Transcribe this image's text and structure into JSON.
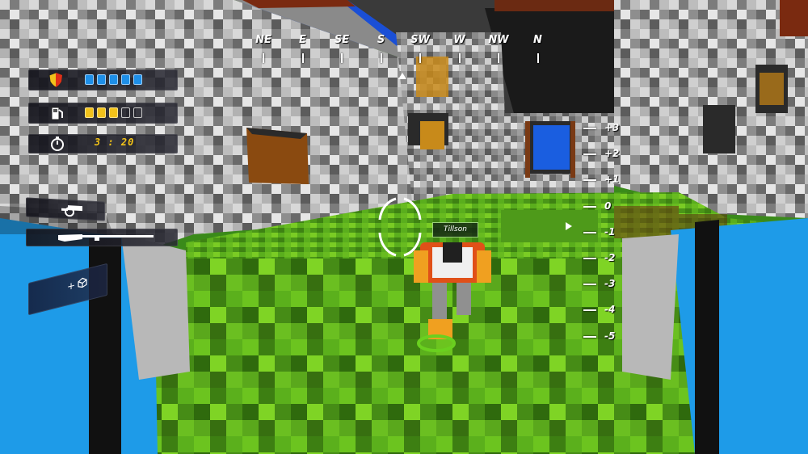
{
  "hud": {
    "compass": {
      "headings": [
        "NE",
        "E",
        "SE",
        "S",
        "SW",
        "W",
        "NW",
        "N"
      ]
    },
    "pitch_ladder": {
      "values": [
        "+3",
        "+2",
        "+1",
        "0",
        "-1",
        "-2",
        "-3",
        "-4",
        "-5"
      ]
    },
    "shield": {
      "icon": "shield-icon",
      "total": 5,
      "filled": 5,
      "color": "#1e8fe8"
    },
    "fuel": {
      "icon": "fuel-pump-icon",
      "total": 5,
      "filled": 3,
      "color": "#f2c21b"
    },
    "timer": {
      "icon": "stopwatch-icon",
      "value": "3 : 20"
    },
    "weapons": [
      {
        "icon": "cannon-icon"
      },
      {
        "icon": "rifle-icon"
      },
      {
        "icon": "add-block-icon",
        "label": "+"
      }
    ],
    "target": {
      "name": "Tillson"
    }
  }
}
